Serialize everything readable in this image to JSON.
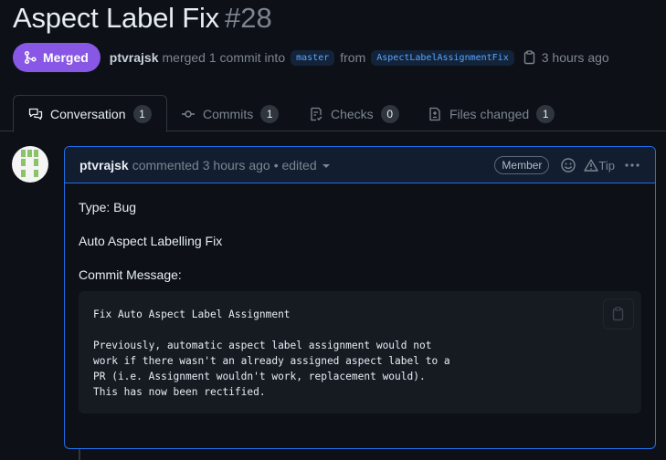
{
  "pr": {
    "title": "Aspect Label Fix",
    "number": "#28",
    "state": "Merged",
    "author": "ptvrajsk",
    "merge_text": "merged 1 commit into",
    "base_branch": "master",
    "from_text": "from",
    "head_branch": "AspectLabelAssignmentFix",
    "time": "3 hours ago"
  },
  "tabs": [
    {
      "label": "Conversation",
      "count": "1",
      "icon": "comment-discussion-icon"
    },
    {
      "label": "Commits",
      "count": "1",
      "icon": "git-commit-icon"
    },
    {
      "label": "Checks",
      "count": "0",
      "icon": "checklist-icon"
    },
    {
      "label": "Files changed",
      "count": "1",
      "icon": "file-diff-icon"
    }
  ],
  "comment": {
    "author": "ptvrajsk",
    "action": "commented 3 hours ago",
    "edited": "• edited",
    "role": "Member",
    "tip": "Tip",
    "body": {
      "type_line": "Type: Bug",
      "summary": "Auto Aspect Labelling Fix",
      "commit_heading": "Commit Message:",
      "code_lines": [
        "Fix Auto Aspect Label Assignment",
        "",
        "Previously, automatic aspect label assignment would not",
        "work if there wasn't an already assigned aspect label to a",
        "PR (i.e. Assignment wouldn't work, replacement would).",
        "This has now been rectified."
      ]
    }
  },
  "colors": {
    "background": "#0d1117",
    "merged": "#8957e5",
    "accent_blue": "#1f6feb",
    "link_blue": "#58a6ff"
  }
}
